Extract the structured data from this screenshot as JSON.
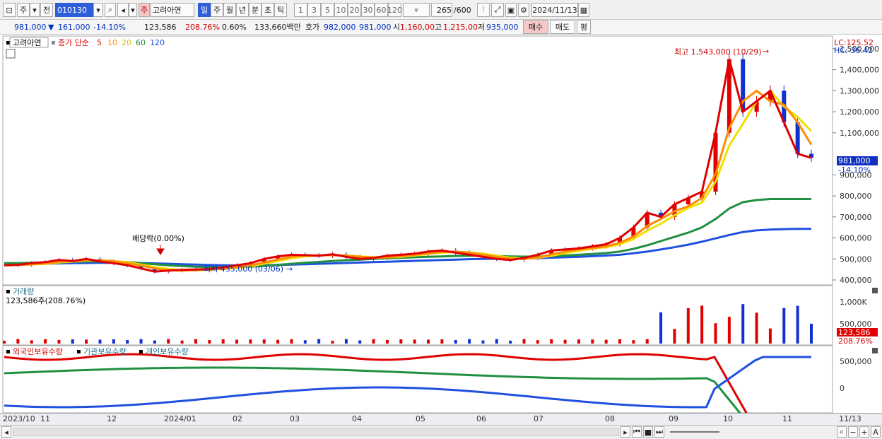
{
  "toolbar": {
    "market_tab": "주",
    "prev_label": "전",
    "code": "010130",
    "dropdown": "▾",
    "stock_tag": "주",
    "stock_name": "고려아연",
    "periods": [
      "일",
      "주",
      "월",
      "년",
      "분",
      "초",
      "틱"
    ],
    "intervals": [
      "1",
      "3",
      "5",
      "10",
      "20",
      "30",
      "60",
      "120"
    ],
    "count": "265",
    "count_max": "/600",
    "date": "2024/11/13"
  },
  "quote": {
    "price": "981,000",
    "arrow": "▼",
    "change": "161,000",
    "change_pct": "-14.10%",
    "volume": "123,586",
    "volume_ratio": "208.76%",
    "turnover": "0.60%",
    "amount": "133,660백만",
    "bid_label": "호가",
    "bid": "982,000",
    "ask": "981,000",
    "open_label": "시",
    "open": "1,160,00",
    "high_label": "고",
    "high": "1,215,00",
    "low_label": "저",
    "low": "935,000",
    "buy_label": "매수",
    "sell_label": "매도",
    "avg_label": "평"
  },
  "price_panel": {
    "name": "고려아연",
    "ma_label": "종가 단순",
    "ma_periods": [
      "5",
      "10",
      "20",
      "60",
      "120"
    ],
    "lc": "LC:125.52",
    "hc": "HC:-36.42",
    "high_note": "최고 1,543,000 (10/29)",
    "low_note": "최저 435,000 (03/06)",
    "dividend_note": "배당락(0.00%)",
    "current_price": "981,000",
    "current_pct": "-14.10%",
    "y_ticks": [
      "1,500,000",
      "1,400,000",
      "1,300,000",
      "1,200,000",
      "1,100,000",
      "900,000",
      "800,000",
      "700,000",
      "600,000",
      "500,000",
      "400,000"
    ]
  },
  "volume_panel": {
    "title": "거래량",
    "value": "123,586주(208.76%)",
    "y_ticks": [
      "1,000K",
      "500,000"
    ],
    "current": "123,586",
    "current_pct": "208.76%"
  },
  "holding_panel": {
    "labels": [
      "외국인보유수량",
      "기관보유수량",
      "개인보유수량"
    ],
    "y_ticks": [
      "500,000",
      "0"
    ]
  },
  "x_axis": [
    "2023/10",
    "11",
    "12",
    "2024/01",
    "02",
    "03",
    "04",
    "05",
    "06",
    "07",
    "08",
    "09",
    "10",
    "11",
    "11/13"
  ],
  "colors": {
    "up": "#e00000",
    "down": "#1030d0",
    "ma5": "#e00000",
    "ma10": "#ff8c00",
    "ma20": "#f0e000",
    "ma60": "#209040",
    "ma120": "#2050e0"
  },
  "chart_data": {
    "type": "line",
    "title": "고려아연",
    "series": [
      {
        "name": "종가",
        "y": [
          470000,
          472000,
          480000,
          485000,
          495000,
          490000,
          500000,
          488000,
          480000,
          470000,
          455000,
          440000,
          445000,
          448000,
          450000,
          452000,
          460000,
          470000,
          480000,
          500000,
          512000,
          520000,
          518000,
          515000,
          522000,
          510000,
          500000,
          505000,
          515000,
          520000,
          525000,
          535000,
          540000,
          530000,
          520000,
          510000,
          500000,
          495000,
          505000,
          520000,
          540000,
          545000,
          550000,
          560000,
          570000,
          600000,
          650000,
          720000,
          700000,
          760000,
          790000,
          820000,
          1100000,
          1450000,
          1200000,
          1250000,
          1300000,
          1150000,
          1000000,
          981000
        ]
      },
      {
        "name": "60",
        "y": [
          480000,
          480000,
          482000,
          484000,
          486000,
          487000,
          488000,
          488000,
          487000,
          485000,
          480000,
          475000,
          470000,
          466000,
          463000,
          461000,
          460000,
          461000,
          463000,
          467000,
          472000,
          477000,
          482000,
          486000,
          490000,
          494000,
          497000,
          500000,
          503000,
          505000,
          508000,
          510000,
          512000,
          514000,
          515000,
          515000,
          514000,
          512000,
          511000,
          511000,
          513000,
          516000,
          520000,
          524000,
          528000,
          535000,
          548000,
          565000,
          585000,
          605000,
          625000,
          650000,
          690000,
          740000,
          770000,
          780000,
          785000,
          785000,
          785000,
          785000
        ]
      },
      {
        "name": "120",
        "y": [
          475000,
          476000,
          477000,
          478000,
          479000,
          480000,
          481000,
          482000,
          482000,
          482000,
          481000,
          479000,
          477000,
          475000,
          473000,
          471000,
          470000,
          469000,
          469000,
          470000,
          471000,
          473000,
          475000,
          477000,
          479000,
          481000,
          483000,
          485000,
          487000,
          489000,
          491000,
          493000,
          495000,
          497000,
          499000,
          500000,
          501000,
          502000,
          503000,
          504000,
          506000,
          508000,
          510000,
          513000,
          516000,
          520000,
          527000,
          535000,
          545000,
          556000,
          568000,
          582000,
          598000,
          614000,
          628000,
          636000,
          640000,
          642000,
          643000,
          643000
        ]
      }
    ],
    "ylim": [
      380000,
      1550000
    ]
  }
}
